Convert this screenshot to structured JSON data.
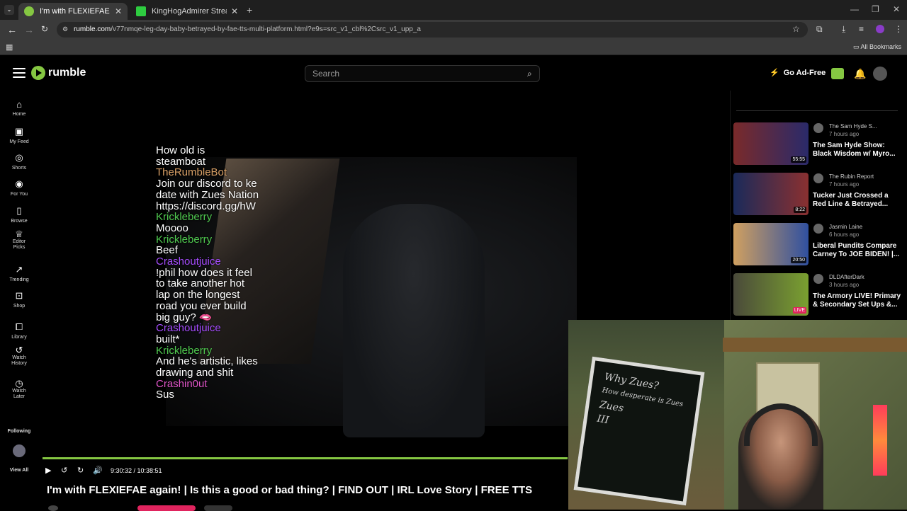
{
  "browser": {
    "tabs": [
      {
        "title": "I'm with FLEXIEFAE again! | Is this",
        "active": true,
        "favicon_color": "#85c742"
      },
      {
        "title": "KingHogAdmirer Stream - Watch",
        "active": false,
        "favicon_color": "#2ecc40"
      }
    ],
    "url_domain": "rumble.com",
    "url_path": "/v77nmqe-leg-day-baby-betrayed-by-fae-tts-multi-platform.html?e9s=src_v1_cbl%2Csrc_v1_upp_a",
    "bookmarks_label": "All Bookmarks"
  },
  "header": {
    "logo_text": "rumble",
    "search_placeholder": "Search",
    "go_ad_free": "Go Ad-Free",
    "accent": "#85c742"
  },
  "sidebar": {
    "items": [
      {
        "label": "Home",
        "icon": "home-icon"
      },
      {
        "label": "My Feed",
        "icon": "feed-icon"
      },
      {
        "label": "Shorts",
        "icon": "shorts-icon"
      },
      {
        "label": "For You",
        "icon": "for-you-icon"
      },
      {
        "label": "Browse",
        "icon": "browse-icon"
      },
      {
        "label": "Editor Picks",
        "icon": "editor-picks-icon"
      },
      {
        "label": "Trending",
        "icon": "trending-icon"
      },
      {
        "label": "Shop",
        "icon": "shop-icon"
      },
      {
        "label": "Library",
        "icon": "library-icon"
      },
      {
        "label": "Watch History",
        "icon": "history-icon"
      },
      {
        "label": "Watch Later",
        "icon": "clock-icon"
      }
    ],
    "following_label": "Following",
    "view_all_label": "View All"
  },
  "video": {
    "time_display": "9:30:32 / 10:38:51",
    "progress_fraction": 0.893,
    "chat": [
      {
        "type": "msg",
        "text": "How old is"
      },
      {
        "type": "msg",
        "text": "steamboat"
      },
      {
        "type": "user",
        "text": "TheRumbleBot",
        "color": "#d9a066"
      },
      {
        "type": "msg",
        "text": "Join our discord to ke"
      },
      {
        "type": "msg",
        "text": "date with Zues Nation"
      },
      {
        "type": "msg",
        "text": "https://discord.gg/hW"
      },
      {
        "type": "user",
        "text": "Krickleberry",
        "color": "#4fc94f"
      },
      {
        "type": "msg",
        "text": "Moooo"
      },
      {
        "type": "user",
        "text": "Krickleberry",
        "color": "#4fc94f"
      },
      {
        "type": "msg",
        "text": "Beef"
      },
      {
        "type": "user",
        "text": "Crashoutjuice",
        "color": "#a64dff"
      },
      {
        "type": "msg",
        "text": "!phil how does it feel"
      },
      {
        "type": "msg",
        "text": "to take another hot"
      },
      {
        "type": "msg",
        "text": "lap on the longest"
      },
      {
        "type": "msg",
        "text": "road you ever build"
      },
      {
        "type": "msg",
        "text": "big guy? 🫦"
      },
      {
        "type": "user",
        "text": "Crashoutjuice",
        "color": "#a64dff"
      },
      {
        "type": "msg",
        "text": "built*"
      },
      {
        "type": "user",
        "text": "Krickleberry",
        "color": "#4fc94f"
      },
      {
        "type": "msg",
        "text": "And he's artistic, likes"
      },
      {
        "type": "msg",
        "text": "drawing and shit"
      },
      {
        "type": "user",
        "text": "Crashin0ut",
        "color": "#e055c8"
      },
      {
        "type": "msg",
        "text": "Sus"
      }
    ],
    "title": "I'm with FLEXIEFAE again! | Is this a good or bad thing? | FIND OUT | IRL Love Story | FREE TTS"
  },
  "recommendations": [
    {
      "channel": "The Sam Hyde S...",
      "ago": "7 hours ago",
      "title": "The Sam Hyde Show: Black Wisdom w/ Myro...",
      "duration": "55:55",
      "thumb_colors": [
        "#7a2a2a",
        "#2a2a6a"
      ]
    },
    {
      "channel": "The Rubin Report",
      "ago": "7 hours ago",
      "title": "Tucker Just Crossed a Red Line & Betrayed...",
      "duration": "8:22",
      "thumb_colors": [
        "#1a2a5a",
        "#8a3030"
      ]
    },
    {
      "channel": "Jasmin Laine",
      "ago": "6 hours ago",
      "title": "Liberal Pundits Compare Carney To JOE BIDEN! |...",
      "duration": "20:50",
      "thumb_colors": [
        "#d0a060",
        "#3050a0"
      ]
    },
    {
      "channel": "DLDAfterDark",
      "ago": "3 hours ago",
      "title": "The Armory LIVE! Primary & Secondary Set Ups &...",
      "duration": "LIVE",
      "thumb_colors": [
        "#4a4a3a",
        "#7aa030"
      ]
    }
  ],
  "webcam": {
    "board_text": [
      "Why Zues?",
      "How desperate is Zues",
      "Zues",
      "III"
    ]
  }
}
